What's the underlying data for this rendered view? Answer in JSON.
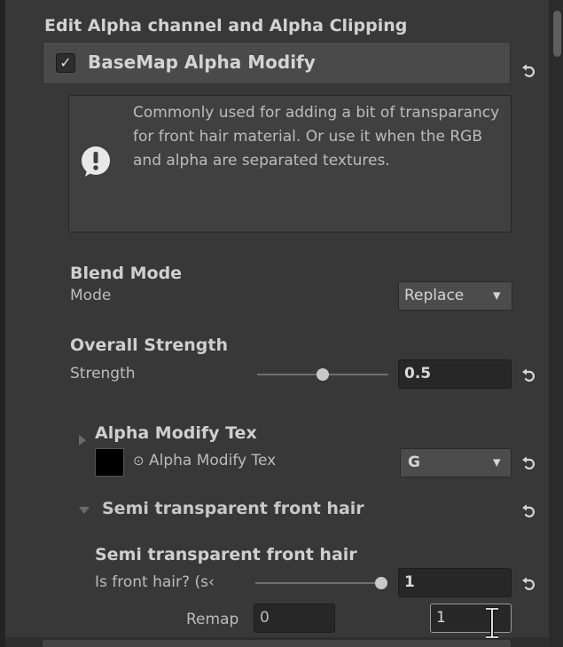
{
  "section": {
    "title": "Edit Alpha channel and Alpha Clipping"
  },
  "toggle": {
    "checked": true,
    "check_glyph": "✓",
    "label": "BaseMap Alpha Modify"
  },
  "help": {
    "icon": "exclamation-bubble-icon",
    "text": "Commonly used for adding a bit of transparancy for front hair material. Or use it when the RGB and alpha are separated textures."
  },
  "blend": {
    "heading": "Blend Mode",
    "label": "Mode",
    "value": "Replace",
    "caret": "▾"
  },
  "strength": {
    "heading": "Overall Strength",
    "label": "Strength",
    "value": "0.5",
    "slider_level": 0.5
  },
  "alpha_tex": {
    "heading": "Alpha Modify Tex",
    "picker_glyph": "⊙",
    "label": "Alpha Modify Tex",
    "channel": "G",
    "caret": "▾"
  },
  "foldout": {
    "label": "Semi transparent front hair",
    "expanded": true
  },
  "front_hair": {
    "heading": "Semi transparent front hair",
    "label": "Is front hair? (s‹",
    "value": "1",
    "slider_level": 1.0
  },
  "remap": {
    "label": "Remap",
    "min": "0",
    "max": "1"
  },
  "colors": {
    "panel_bg": "#383838",
    "row_bg": "#4a4a4a",
    "field_bg": "#272727",
    "text": "#c4c4c4"
  },
  "icons": {
    "reset": "reset-arrow-icon",
    "foldout_closed": "triangle-right-icon",
    "foldout_open": "triangle-down-icon",
    "cursor": "text-cursor-icon"
  }
}
